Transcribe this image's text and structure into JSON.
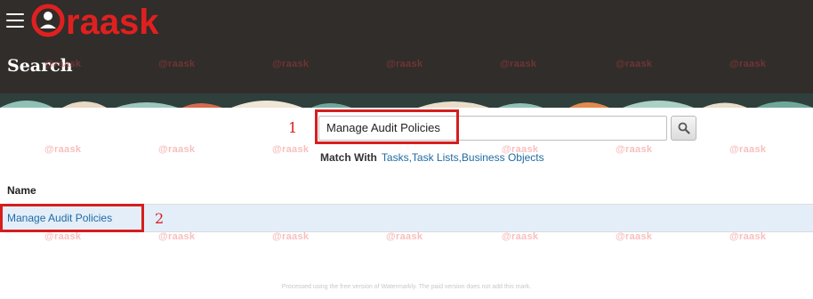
{
  "header": {
    "brand": "raask",
    "page_title": "Search"
  },
  "search": {
    "value": "Manage Audit Policies",
    "match_with_label": "Match With",
    "match_with_value": "Tasks,Task Lists,Business Objects"
  },
  "results": {
    "column_header": "Name",
    "rows": [
      {
        "name": "Manage Audit Policies"
      }
    ]
  },
  "annotations": {
    "callout_1": "1",
    "callout_2": "2"
  },
  "watermark": {
    "text": "@raask"
  },
  "footer_note": "Processed using the free version of Watermarkly. The paid version does not add this mark.",
  "colors": {
    "header_bg": "#312d2a",
    "link": "#1f6ba3",
    "row_highlight": "#e3eef9",
    "callout": "#d61e1e",
    "brand_red": "#e02020"
  },
  "icons": {
    "menu": "hamburger-menu-icon",
    "search": "magnifier-icon"
  }
}
